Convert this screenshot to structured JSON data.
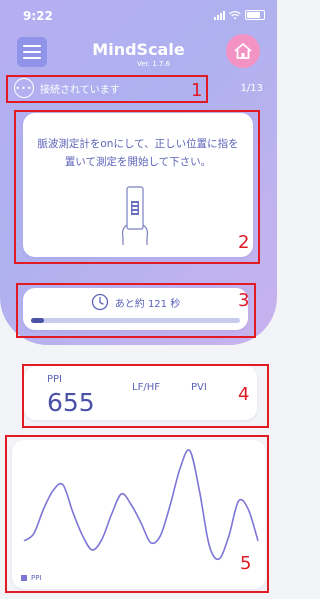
{
  "status": {
    "time": "9:22"
  },
  "header": {
    "title": "MindScale",
    "version": "Ver. 1.7.6"
  },
  "connection": {
    "text": "接続されています",
    "counter": "1/13"
  },
  "instruction": {
    "text": "脈波測定計をonにして、正しい位置に指を置いて測定を開始して下さい。"
  },
  "timer": {
    "text": "あと約 121 秒",
    "progress": 0.06
  },
  "metrics": {
    "ppi_label": "PPI",
    "ppi_value": "655",
    "lfhf_label": "LF/HF",
    "pvi_label": "PVI"
  },
  "annotations": [
    "1",
    "2",
    "3",
    "4",
    "5"
  ],
  "colors": {
    "accent": "#5c63b9",
    "line": "#7d76d7",
    "home": "#f393c3",
    "annotation": "#e01b24"
  },
  "chart_data": {
    "type": "line",
    "series": [
      {
        "name": "PPI",
        "values": [
          620,
          628,
          655,
          676,
          682,
          652,
          626,
          610,
          622,
          650,
          672,
          660,
          640,
          618,
          626,
          660,
          700,
          720,
          675,
          615,
          600,
          625,
          664,
          655,
          620
        ]
      }
    ]
  }
}
